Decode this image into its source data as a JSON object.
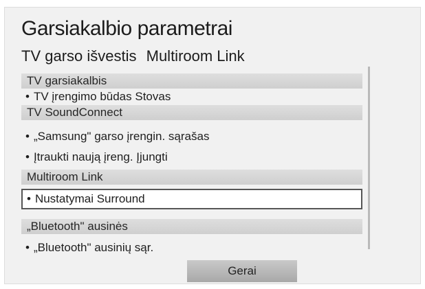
{
  "dialog": {
    "title": "Garsiakalbio parametrai",
    "tabs": [
      "TV garso išvestis",
      "Multiroom Link"
    ]
  },
  "sections": [
    {
      "header": "TV garsiakalbis",
      "items": [
        "TV įrengimo būdas Stovas"
      ]
    },
    {
      "header": "TV SoundConnect",
      "items": [
        "„Samsung\" garso įrengin. sąrašas",
        "Įtraukti naują įreng. Įjungti"
      ]
    },
    {
      "header": "Multiroom Link",
      "items": [
        "Nustatymai Surround"
      ]
    },
    {
      "header": "„Bluetooth\" ausinės",
      "items": [
        "„Bluetooth\" ausinių sąr."
      ]
    }
  ],
  "bullet": "•",
  "selected_item": "Nustatymai Surround",
  "ok_button": "Gerai",
  "colors": {
    "panel": "#f1f1f1",
    "header": "#d6d6d6",
    "selected_border": "#555555",
    "button": "#b8b8b8"
  }
}
